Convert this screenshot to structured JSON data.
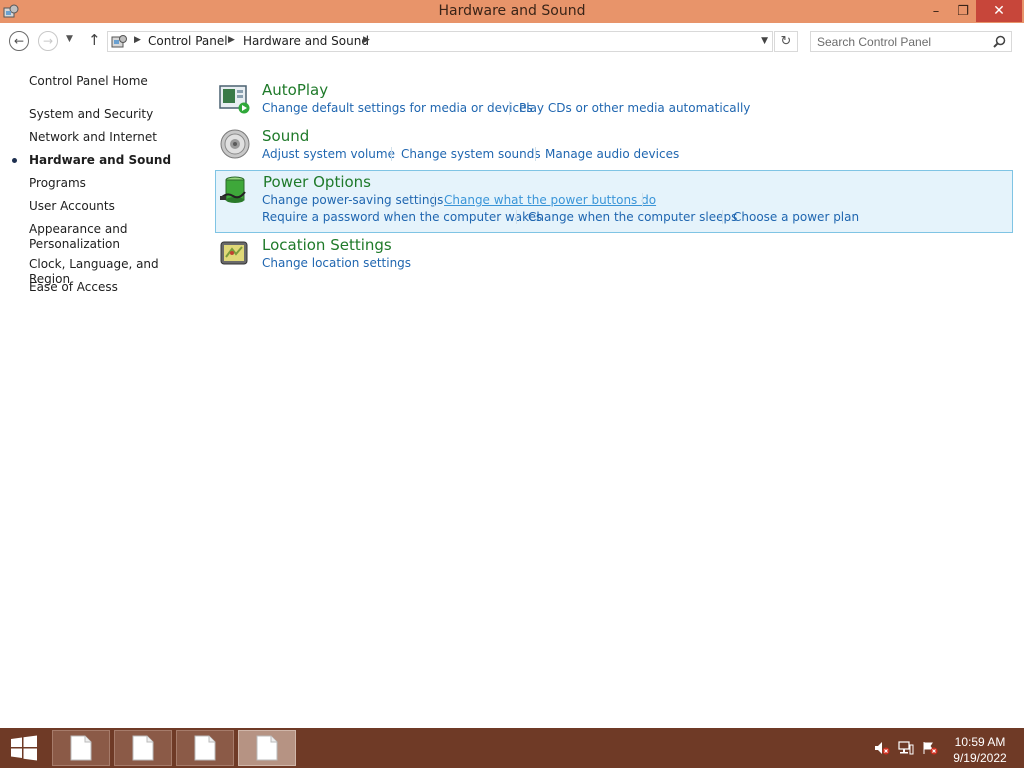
{
  "window": {
    "title": "Hardware and Sound",
    "minimize": "–",
    "restore": "❐",
    "close": "✕"
  },
  "navigation": {
    "breadcrumbs": [
      "Control Panel",
      "Hardware and Sound"
    ],
    "search_placeholder": "Search Control Panel"
  },
  "sidebar": {
    "items": [
      {
        "label": "Control Panel Home"
      },
      {
        "label": "System and Security"
      },
      {
        "label": "Network and Internet"
      },
      {
        "label": "Hardware and Sound",
        "active": true
      },
      {
        "label": "Programs"
      },
      {
        "label": "User Accounts"
      },
      {
        "label": "Appearance and Personalization"
      },
      {
        "label": "Clock, Language, and Region"
      },
      {
        "label": "Ease of Access"
      }
    ]
  },
  "categories": [
    {
      "title": "AutoPlay",
      "icon": "autoplay-icon",
      "links": [
        "Change default settings for media or devices",
        "Play CDs or other media automatically"
      ]
    },
    {
      "title": "Sound",
      "icon": "speaker-icon",
      "links": [
        "Adjust system volume",
        "Change system sounds",
        "Manage audio devices"
      ]
    },
    {
      "title": "Power Options",
      "icon": "battery-icon",
      "highlighted": true,
      "links": [
        "Change power-saving settings",
        "Change what the power buttons do",
        "Require a password when the computer wakes",
        "Change when the computer sleeps",
        "Choose a power plan"
      ]
    },
    {
      "title": "Location Settings",
      "icon": "location-icon",
      "links": [
        "Change location settings"
      ]
    }
  ],
  "taskbar": {
    "apps": [
      "document-icon",
      "document-icon",
      "document-icon",
      "document-icon"
    ],
    "tray": [
      "volume-muted-icon",
      "network-icon",
      "action-center-icon"
    ],
    "time": "10:59 AM",
    "date": "9/19/2022"
  },
  "colors": {
    "titlebar": "#e8946a",
    "taskbar": "#6f3a26",
    "category_title": "#1f7a2a",
    "link": "#1f66b0",
    "highlight_bg": "#e5f3fb"
  }
}
